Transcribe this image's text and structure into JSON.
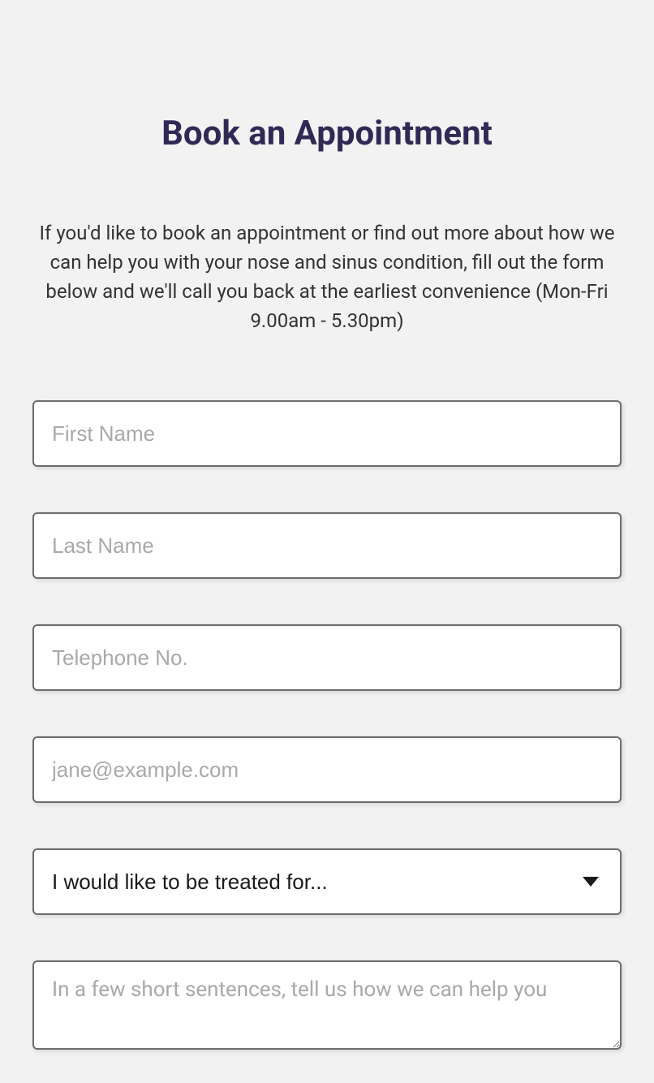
{
  "heading": "Book an Appointment",
  "description": "If you'd like to book an appointment or find out more about how we can help you with your nose and sinus condition, fill out the form below and we'll call you back at the earliest convenience (Mon-Fri 9.00am - 5.30pm)",
  "form": {
    "first_name": {
      "placeholder": "First Name",
      "value": ""
    },
    "last_name": {
      "placeholder": "Last Name",
      "value": ""
    },
    "telephone": {
      "placeholder": "Telephone No.",
      "value": ""
    },
    "email": {
      "placeholder": "jane@example.com",
      "value": ""
    },
    "treatment_select": {
      "selected": "I would like to be treated for..."
    },
    "message": {
      "placeholder": "In a few short sentences, tell us how we can help you",
      "value": ""
    }
  }
}
